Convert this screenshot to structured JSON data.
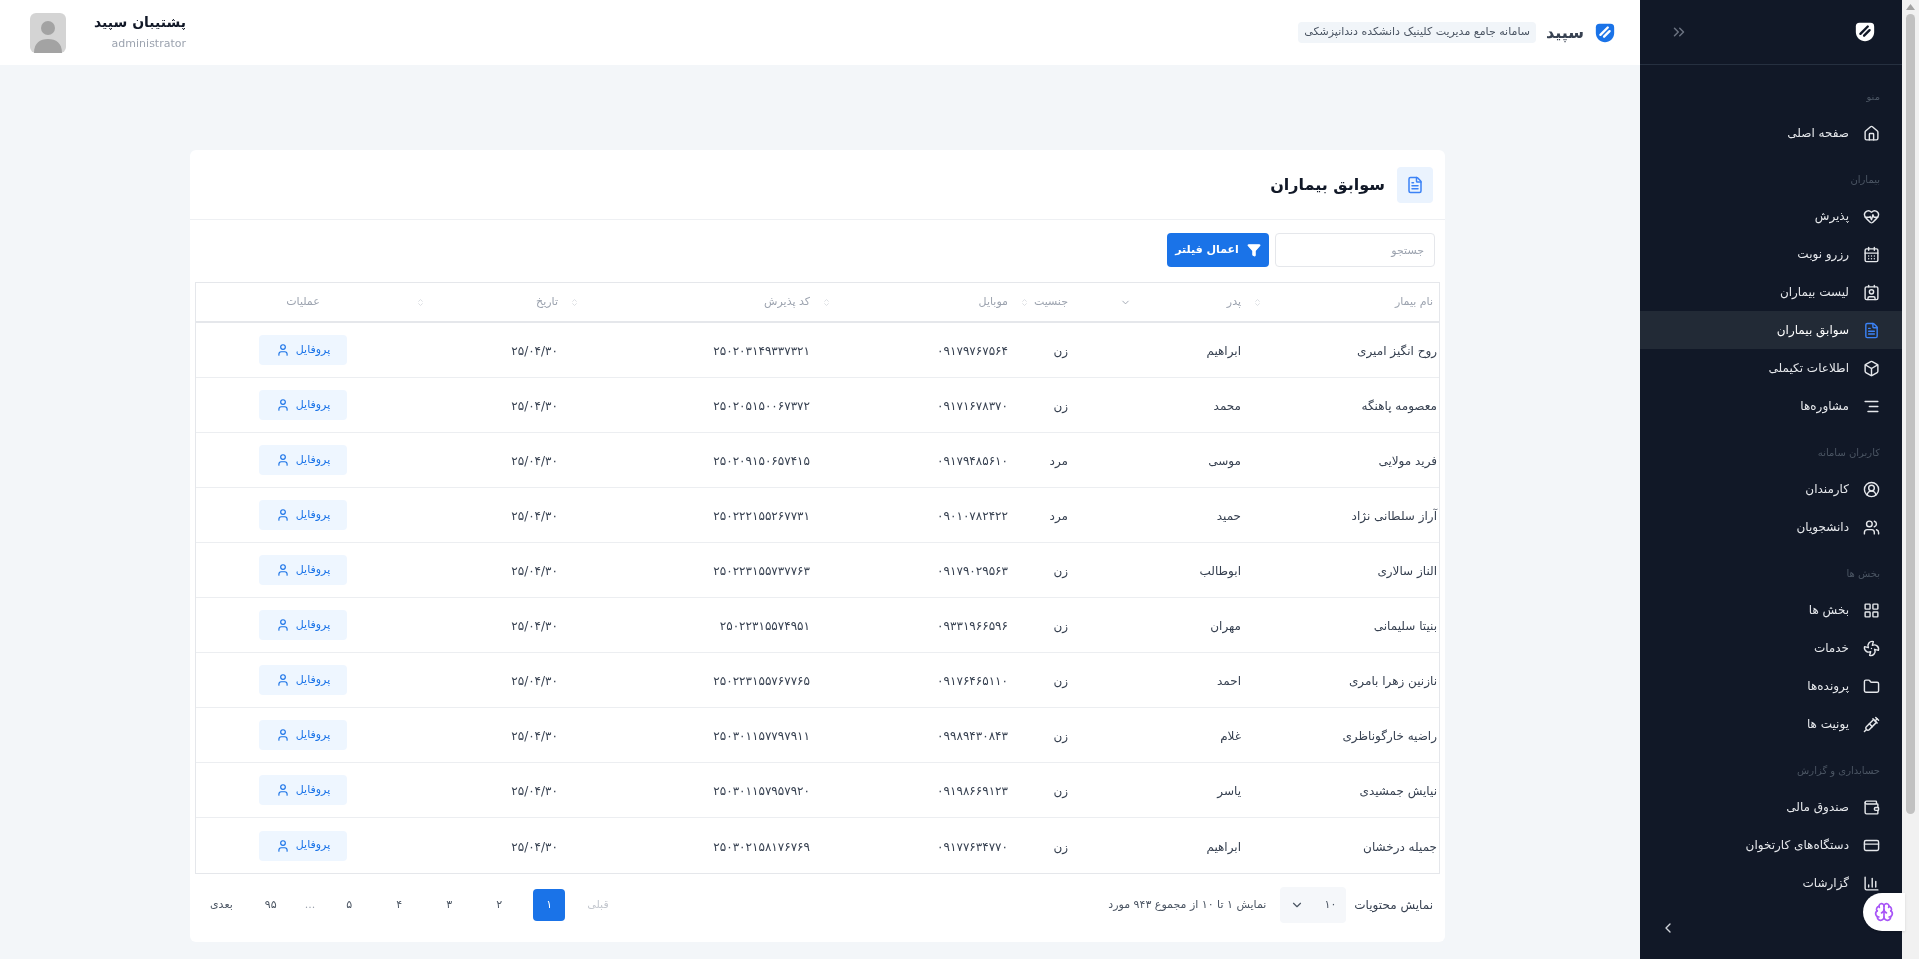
{
  "app": {
    "brand": "سپید",
    "subtitle": "سامانه جامع مدیریت کلینیک دانشکده دندانپزشکی"
  },
  "user": {
    "name": "پشتیبان سپید",
    "role": "administrator"
  },
  "sidebar": {
    "sections": [
      {
        "title": "منو",
        "items": [
          {
            "label": "صفحه اصلی",
            "selected": false
          }
        ]
      },
      {
        "title": "بیماران",
        "items": [
          {
            "label": "پذیرش",
            "selected": false
          },
          {
            "label": "رزرو نوبت",
            "selected": false
          },
          {
            "label": "لیست بیماران",
            "selected": false
          },
          {
            "label": "سوابق بیماران",
            "selected": true
          },
          {
            "label": "اطلاعات تکیملی",
            "selected": false
          },
          {
            "label": "مشاوره‌ها",
            "selected": false
          }
        ]
      },
      {
        "title": "کاربران سامانه",
        "items": [
          {
            "label": "کارمندان",
            "selected": false
          },
          {
            "label": "دانشجویان",
            "selected": false
          }
        ]
      },
      {
        "title": "بخش ها",
        "items": [
          {
            "label": "بخش ها",
            "selected": false
          },
          {
            "label": "خدمات",
            "selected": false
          },
          {
            "label": "پرونده‌ها",
            "selected": false
          },
          {
            "label": "یونیت ها",
            "selected": false
          }
        ]
      },
      {
        "title": "حسابداری و گزارش",
        "items": [
          {
            "label": "صندوق مالی",
            "selected": false
          },
          {
            "label": "دستگاه‌های کارتخوان",
            "selected": false
          },
          {
            "label": "گزارشات",
            "selected": false
          }
        ]
      }
    ]
  },
  "page": {
    "title": "سوابق بیماران"
  },
  "search": {
    "placeholder": "جستجو"
  },
  "filter_button": "اعمال فیلتر",
  "table": {
    "columns": [
      {
        "label": "نام بیمار",
        "sortable": true,
        "sorted": false
      },
      {
        "label": "پدر",
        "sortable": true,
        "sorted": true
      },
      {
        "label": "جنسیت",
        "sortable": true,
        "sorted": false
      },
      {
        "label": "موبایل",
        "sortable": true,
        "sorted": false
      },
      {
        "label": "کد پذیرش",
        "sortable": true,
        "sorted": false
      },
      {
        "label": "تاریخ",
        "sortable": true,
        "sorted": false
      },
      {
        "label": "عملیات",
        "sortable": false,
        "sorted": false
      }
    ],
    "rows": [
      {
        "cells": [
          "روح انگیز امیری",
          "ابراهیم",
          "زن",
          "۰۹۱۷۹۷۶۷۵۶۴",
          "۲۵۰۲۰۳۱۴۹۳۳۷۳۲۱",
          "۲۵/۰۴/۳۰"
        ],
        "action": "پروفایل"
      },
      {
        "cells": [
          "معصومه پاهنگه",
          "محمد",
          "زن",
          "۰۹۱۷۱۶۷۸۳۷۰",
          "۲۵۰۲۰۵۱۵۰۰۶۷۳۷۲",
          "۲۵/۰۴/۳۰"
        ],
        "action": "پروفایل"
      },
      {
        "cells": [
          "فرید مولایی",
          "موسی",
          "مرد",
          "۰۹۱۷۹۴۸۵۶۱۰",
          "۲۵۰۲۰۹۱۵۰۶۵۷۴۱۵",
          "۲۵/۰۴/۳۰"
        ],
        "action": "پروفایل"
      },
      {
        "cells": [
          "آراز سلطانی نژاد",
          "حمید",
          "مرد",
          "۰۹۰۱۰۷۸۲۴۲۲",
          "۲۵۰۲۲۲۱۵۵۲۶۷۷۳۱",
          "۲۵/۰۴/۳۰"
        ],
        "action": "پروفایل"
      },
      {
        "cells": [
          "الناز سالاری",
          "ابوطالب",
          "زن",
          "۰۹۱۷۹۰۲۹۵۶۳",
          "۲۵۰۲۲۳۱۵۵۷۳۷۷۶۳",
          "۲۵/۰۴/۳۰"
        ],
        "action": "پروفایل"
      },
      {
        "cells": [
          "بنیتا سلیمانی",
          "مهران",
          "زن",
          "۰۹۳۳۱۹۶۶۵۹۶",
          "۲۵۰۲۲۳۱۵۵۷۴۹۵۱",
          "۲۵/۰۴/۳۰"
        ],
        "action": "پروفایل"
      },
      {
        "cells": [
          "نازنین زهرا بامری",
          "احمد",
          "زن",
          "۰۹۱۷۶۴۶۵۱۱۰",
          "۲۵۰۲۲۳۱۵۵۷۶۷۷۶۵",
          "۲۵/۰۴/۳۰"
        ],
        "action": "پروفایل"
      },
      {
        "cells": [
          "راضیه خارگوناظری",
          "غلام",
          "زن",
          "۰۹۹۸۹۴۳۰۸۴۳",
          "۲۵۰۳۰۱۱۵۷۷۹۷۹۱۱",
          "۲۵/۰۴/۳۰"
        ],
        "action": "پروفایل"
      },
      {
        "cells": [
          "نیایش جمشیدی",
          "یاسر",
          "زن",
          "۰۹۱۹۸۶۶۹۱۲۳",
          "۲۵۰۳۰۱۱۵۷۹۵۷۹۲۰",
          "۲۵/۰۴/۳۰"
        ],
        "action": "پروفایل"
      },
      {
        "cells": [
          "جمیله درخشان",
          "ابراهیم",
          "زن",
          "۰۹۱۷۷۶۳۴۷۷۰",
          "۲۵۰۳۰۲۱۵۸۱۷۶۷۶۹",
          "۲۵/۰۴/۳۰"
        ],
        "action": "پروفایل"
      }
    ]
  },
  "pagination": {
    "page_size_label": "نمایش محتویات",
    "page_size": "۱۰",
    "summary": "نمایش ۱ تا ۱۰ از مجموع ۹۴۳ مورد",
    "items": [
      {
        "kind": "prev",
        "label": "قبلی",
        "disabled": true
      },
      {
        "kind": "page",
        "label": "۱",
        "selected": true
      },
      {
        "kind": "page",
        "label": "۲",
        "selected": false
      },
      {
        "kind": "page",
        "label": "۳",
        "selected": false
      },
      {
        "kind": "page",
        "label": "۴",
        "selected": false
      },
      {
        "kind": "page",
        "label": "۵",
        "selected": false
      },
      {
        "kind": "ellipsis",
        "label": "..."
      },
      {
        "kind": "page",
        "label": "۹۵",
        "selected": false
      },
      {
        "kind": "next",
        "label": "بعدی",
        "disabled": false
      }
    ]
  }
}
